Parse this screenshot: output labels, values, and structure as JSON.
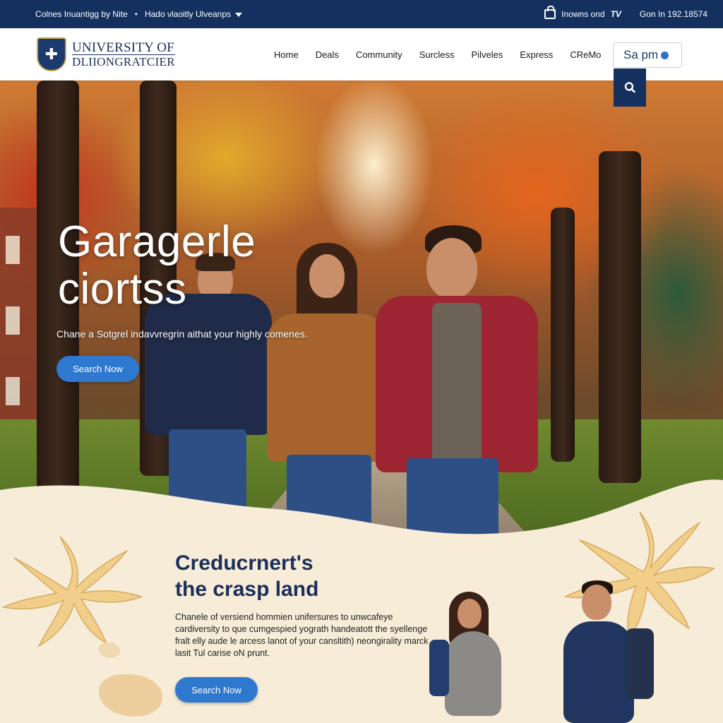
{
  "utility_bar": {
    "left_text": "Colnes Inuantigg by Nite",
    "link_text": "Hado vlaoitly Ulveanps",
    "bag_label": "Inowns ond",
    "tv_label": "TV",
    "phone_text": "Gon In 192.18574"
  },
  "header": {
    "logo_line1": "UNIVERSITY OF",
    "logo_line2": "DLIIONGRATCIER",
    "nav": [
      "Home",
      "Deals",
      "Community",
      "Surcless",
      "Pilveles",
      "Express",
      "CReMo"
    ],
    "search_value": "Sa pm"
  },
  "hero": {
    "title_line1": "Garagerle",
    "title_line2": "ciortss",
    "subtitle": "Chane a Sotgrel indavvregrin aithat your highly comenes.",
    "cta_label": "Search Now"
  },
  "section": {
    "title_line1": "Creducrnert's",
    "title_line2": "the crasp land",
    "body": "Chanele of versiend hommien unifersures to unwcafeye cardiversity to que cumgespied yograth handeatott the syellenge fralt elly aude le arcess lanot of your cansltith) neongirality marck lasit Tul carise oN prunt.",
    "cta_label": "Search Now"
  },
  "colors": {
    "navy": "#13305f",
    "accent_blue": "#2f78cf",
    "cream": "#f6ecd8",
    "leaf": "#f0cf8a"
  }
}
